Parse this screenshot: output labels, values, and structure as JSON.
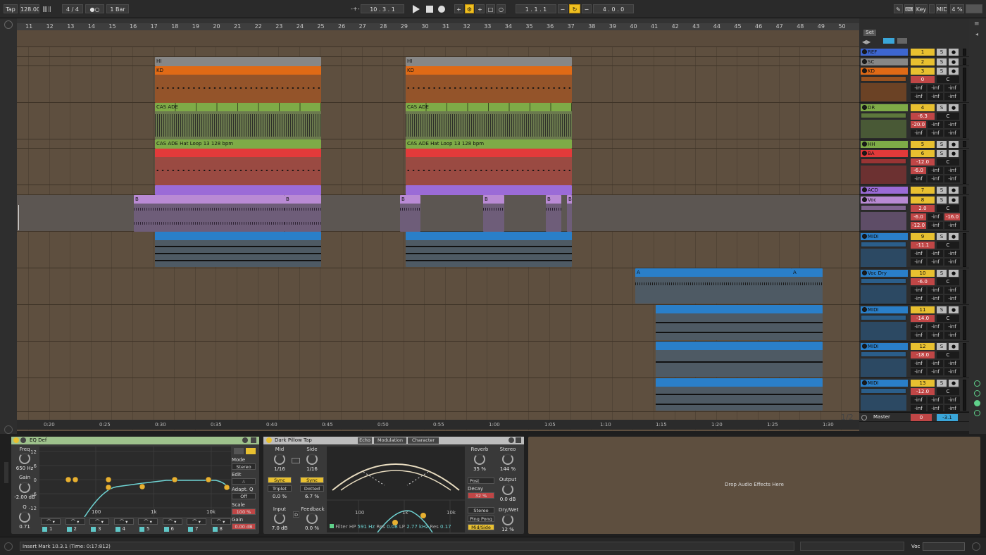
{
  "colors": {
    "reference": "#3d66d1",
    "sidechain": "#878787",
    "kick": "#e06a16",
    "drums": "#7eab47",
    "hats": "#7eab47",
    "bass": "#e23a3a",
    "acid": "#9b6bd7",
    "vocal": "#b98ad4",
    "midi": "#2a7fc9",
    "vocal_dry": "#2a7fc9",
    "track_number": "#e8c030",
    "arrangement_bg": "#5e4f3f",
    "edit_mode": "#f0c020"
  },
  "transport": {
    "tap": "Tap",
    "tempo": "128.00",
    "signature": "4 / 4",
    "metronome": "●○",
    "quantize": "1 Bar",
    "position": "10 .  3 .  1",
    "loop_start": "1 .  1 .  1",
    "loop_length": "4 .  0 .  0",
    "key_label": "Key",
    "midi_label": "MIDI",
    "cpu": "4 %"
  },
  "ruler": {
    "bars": [
      "11",
      "12",
      "13",
      "14",
      "15",
      "16",
      "17",
      "18",
      "19",
      "20",
      "21",
      "22",
      "23",
      "24",
      "25",
      "26",
      "27",
      "28",
      "29",
      "30",
      "31",
      "32",
      "33",
      "34",
      "35",
      "36",
      "37",
      "38",
      "39",
      "40",
      "41",
      "42",
      "43",
      "44",
      "45",
      "46",
      "47",
      "48",
      "49",
      "50"
    ]
  },
  "timeline": {
    "times": [
      "0:20",
      "0:25",
      "0:30",
      "0:35",
      "0:40",
      "0:45",
      "0:50",
      "0:55",
      "1:00",
      "1:05",
      "1:10",
      "1:15",
      "1:20",
      "1:25",
      "1:30"
    ],
    "page": "1/2"
  },
  "set_label": "Set",
  "clips": {
    "hi": "HI",
    "kd": "KD",
    "drum_loop": "CAS ADE",
    "hat_loop": "CAS ADE Hat Loop 13 128 bpm",
    "b": "B",
    "a": "A"
  },
  "tracks": [
    {
      "name": "REF",
      "number": "1",
      "icon": "play-icon"
    },
    {
      "name": "SC",
      "number": "2",
      "icon": "play-icon"
    },
    {
      "name": "KD",
      "number": "3",
      "icon": "chevron-down-icon",
      "vol": "0",
      "pan": "C",
      "sends": [
        "-inf",
        "-inf",
        "-inf"
      ]
    },
    {
      "name": "DR",
      "number": "4",
      "icon": "chevron-down-icon",
      "vol": "-6.3",
      "pan": "C",
      "sends": [
        "-20.0",
        "-inf",
        "-inf"
      ]
    },
    {
      "name": "HH",
      "number": "5",
      "icon": "play-icon"
    },
    {
      "name": "BA",
      "number": "6",
      "icon": "chevron-down-icon",
      "vol": "-12.0",
      "pan": "C",
      "sends": [
        "-6.0",
        "-inf",
        "-inf"
      ]
    },
    {
      "name": "ACD",
      "number": "7",
      "icon": "play-icon"
    },
    {
      "name": "Voc",
      "number": "8",
      "icon": "chevron-down-icon",
      "vol": "2.0",
      "pan": "C",
      "sends": [
        "-6.0",
        "-inf",
        "-16.0"
      ],
      "extra": [
        "-12.0",
        "-inf",
        "-inf"
      ]
    },
    {
      "name": "MIDI",
      "number": "9",
      "icon": "chevron-down-icon",
      "vol": "-11.1",
      "pan": "C",
      "sends": [
        "-inf",
        "-inf",
        "-inf"
      ],
      "extra": [
        "-inf",
        "-inf",
        "-inf"
      ]
    },
    {
      "name": "Voc Dry",
      "number": "10",
      "icon": "chevron-down-icon",
      "vol": "-6.0",
      "pan": "C",
      "sends": [
        "-inf",
        "-inf",
        "-inf"
      ],
      "extra": [
        "-inf",
        "-inf",
        "-inf"
      ]
    },
    {
      "name": "MIDI",
      "number": "11",
      "icon": "chevron-down-icon",
      "vol": "-14.0",
      "pan": "C",
      "sends": [
        "-inf",
        "-inf",
        "-inf"
      ],
      "extra": [
        "-inf",
        "-inf",
        "-inf"
      ]
    },
    {
      "name": "MIDI",
      "number": "12",
      "icon": "chevron-down-icon",
      "vol": "-18.0",
      "pan": "C",
      "sends": [
        "-inf",
        "-inf",
        "-inf"
      ],
      "extra": [
        "-inf",
        "-inf",
        "-inf"
      ]
    },
    {
      "name": "MIDI",
      "number": "13",
      "icon": "chevron-down-icon",
      "vol": "-12.0",
      "pan": "C",
      "sends": [
        "-inf",
        "-inf",
        "-inf"
      ],
      "extra": [
        "-inf",
        "-inf",
        "-inf"
      ]
    }
  ],
  "master": {
    "name": "Master",
    "vol": "0",
    "pan": "-3.1"
  },
  "solo": "S",
  "eq": {
    "title": "EQ Def",
    "freq_label": "Freq",
    "freq": "650 Hz",
    "gain_label": "Gain",
    "gain": "-2.00 dB",
    "q_label": "Q",
    "q": "0.71",
    "db_ticks": [
      "12",
      "6",
      "0",
      "-6",
      "-12"
    ],
    "hz_ticks": [
      "100",
      "1k",
      "10k"
    ],
    "mode_label": "Mode",
    "mode": "Stereo",
    "edit_label": "Edit",
    "edit_value": "A",
    "adapt_label": "Adapt. Q",
    "adapt": "Off",
    "scale_label": "Scale",
    "scale": "100 %",
    "out_gain_label": "Gain",
    "out_gain": "0.00 dB",
    "bands": [
      "1",
      "2",
      "3",
      "4",
      "5",
      "6",
      "7",
      "8"
    ],
    "band_icons": [
      "high-pass-icon",
      "low-shelf-icon",
      "bell-icon",
      "bell-icon",
      "bell-icon",
      "high-shelf-icon",
      "bell-icon",
      "low-pass-icon"
    ]
  },
  "delay": {
    "title": "Dark Pillow Tap",
    "mid_label": "Mid",
    "mid": "1/16",
    "side_label": "Side",
    "side": "1/16",
    "sync": "Sync",
    "mode_l": "Triplet",
    "mode_r": "Dotted",
    "offset_l": "0.0 %",
    "offset_r": "6.7 %",
    "input_label": "Input",
    "input": "7.0 dB",
    "feedback_label": "Feedback",
    "feedback": "0.0 %",
    "d_btn": "D",
    "tabs": [
      "Echo",
      "Modulation",
      "Character"
    ],
    "hz_ticks": [
      "100",
      "1k",
      "10k"
    ],
    "filter_label": "Filter",
    "hp_label": "HP",
    "hp": "591 Hz",
    "res_label": "Res",
    "res_hp": "0.08",
    "lp_label": "LP",
    "lp": "2.77 kHz",
    "res_lp": "0.17",
    "reverb_label": "Reverb",
    "reverb": "35 %",
    "stereo_label": "Stereo",
    "stereo": "144 %",
    "reverb_pos": "Post",
    "decay_label": "Decay",
    "decay": "32 %",
    "output_label": "Output",
    "output": "0.0 dB",
    "stereo_btn": "Stereo",
    "pingpong_btn": "Ping Pong",
    "midside_btn": "Mid/Side",
    "drywet_label": "Dry/Wet",
    "drywet": "12 %"
  },
  "drop_zone": "Drop Audio Effects Here",
  "status": {
    "message": "Insert Mark 10.3.1 (Time: 0:17:812)",
    "track": "Voc"
  }
}
